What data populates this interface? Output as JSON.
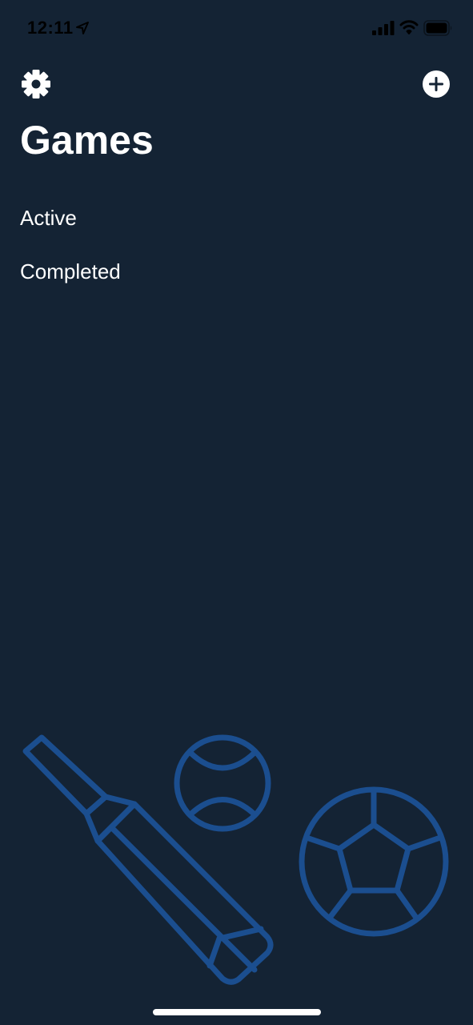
{
  "status_bar": {
    "time": "12:11",
    "location_icon": "location-arrow-icon",
    "signal_icon": "cellular-signal-icon",
    "wifi_icon": "wifi-icon",
    "battery_icon": "battery-icon"
  },
  "header": {
    "settings_icon": "gear-icon",
    "add_icon": "plus-circle-icon",
    "title": "Games"
  },
  "sections": [
    {
      "label": "Active"
    },
    {
      "label": "Completed"
    }
  ],
  "illustration": {
    "items": [
      "cricket-bat-icon",
      "cricket-ball-icon",
      "soccer-ball-icon"
    ],
    "color": "#1B4E8F"
  },
  "colors": {
    "background": "#142334",
    "text": "#FFFFFF",
    "illustration": "#1B4E8F"
  }
}
